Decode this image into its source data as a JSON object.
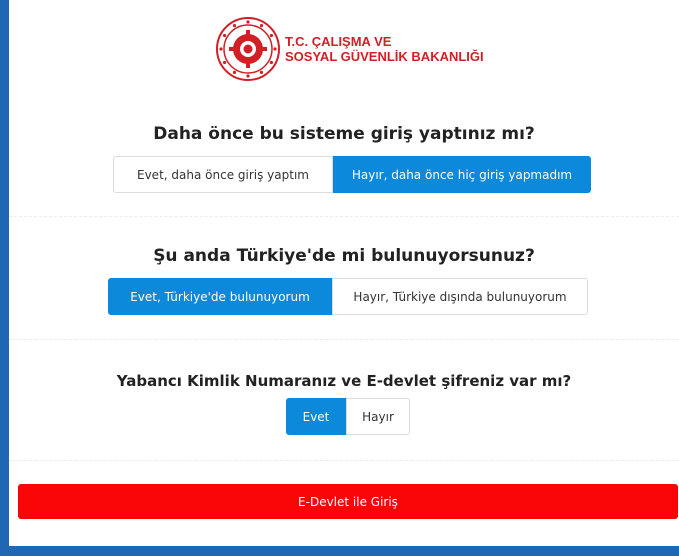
{
  "header": {
    "ministry_line1": "T.C. ÇALIŞMA VE",
    "ministry_line2": "SOSYAL GÜVENLİK BAKANLIĞI"
  },
  "questions": [
    {
      "text": "Daha önce bu sisteme giriş yaptınız mı?",
      "options": [
        "Evet, daha önce giriş yaptım",
        "Hayır, daha önce hiç giriş yapmadım"
      ],
      "selected": "Hayır, daha önce hiç giriş yapmadım"
    },
    {
      "text": "Şu anda Türkiye'de mi bulunuyorsunuz?",
      "options": [
        "Evet, Türkiye'de bulunuyorum",
        "Hayır, Türkiye dışında bulunuyorum"
      ],
      "selected": "Evet, Türkiye'de bulunuyorum"
    },
    {
      "text": "Yabancı Kimlik Numaranız ve E-devlet şifreniz var mı?",
      "options": [
        "Evet",
        "Hayır"
      ],
      "selected": "Evet"
    }
  ],
  "login_button": "E-Devlet ile Giriş",
  "colors": {
    "frame_border": "#1f67b3",
    "selected": "#0d89dc",
    "login": "#fa0505",
    "brand_red": "#d21f26"
  },
  "icons": {
    "logo": "ministry-emblem-icon"
  }
}
